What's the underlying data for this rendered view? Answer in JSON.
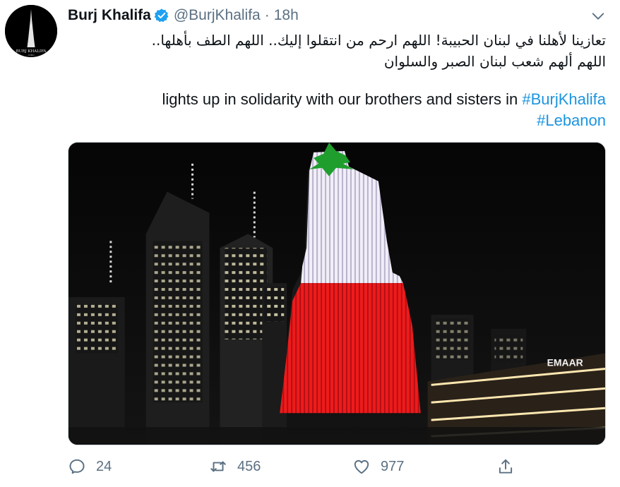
{
  "tweet": {
    "author": {
      "name": "Burj Khalifa",
      "handle": "@BurjKhalifa",
      "verified": true,
      "avatar_label": "BURJ KHALIFA",
      "avatar_sublabel": "DUBAI"
    },
    "time_separator": "·",
    "time": "18h",
    "text_arabic_line1": "تعازينا لأهلنا في لبنان الحبيبة! اللهم ارحم من انتقلوا إليك.. اللهم الطف بأهلها..",
    "text_arabic_line2": "اللهم ألهم شعب لبنان الصبر والسلوان",
    "text_english": "lights up in solidarity with our brothers and sisters in",
    "hashtag_1": "#BurjKhalifa",
    "hashtag_2": "#Lebanon",
    "media": {
      "sign_text": "EMAAR"
    },
    "actions": {
      "replies": "24",
      "retweets": "456",
      "likes": "977"
    }
  },
  "colors": {
    "link": "#1b95e0",
    "verified": "#1da1f2",
    "muted": "#5b7083",
    "flag_red": "#e8141b",
    "flag_green": "#1f9e2e"
  },
  "icons": {
    "caret": "chevron-down-icon",
    "verified": "verified-badge-icon",
    "reply": "reply-icon",
    "retweet": "retweet-icon",
    "like": "heart-icon",
    "share": "share-icon"
  }
}
